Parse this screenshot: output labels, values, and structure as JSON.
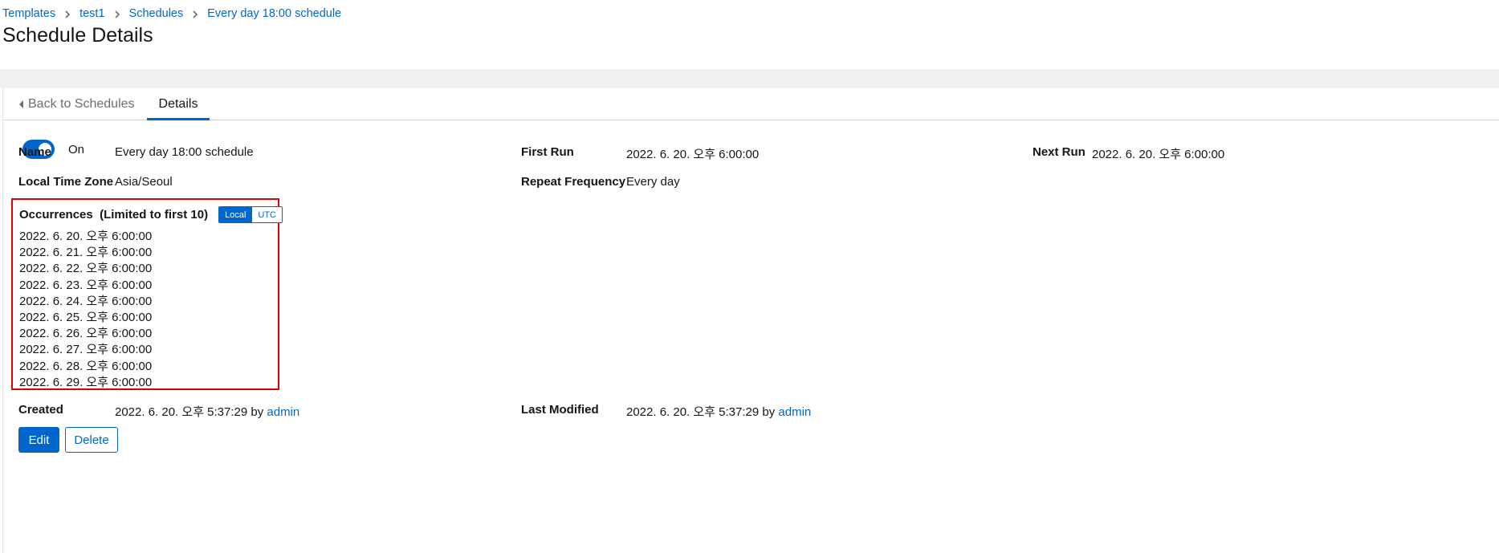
{
  "breadcrumb": {
    "items": [
      "Templates",
      "test1",
      "Schedules",
      "Every day 18:00 schedule"
    ]
  },
  "page": {
    "title": "Schedule Details"
  },
  "tabs": {
    "back_label": "Back to Schedules",
    "details_label": "Details"
  },
  "schedule": {
    "enabled": true,
    "toggle_label": "On",
    "name_label": "Name",
    "name_value": "Every day 18:00 schedule",
    "first_run_label": "First Run",
    "first_run_value": "2022. 6. 20. 오후 6:00:00",
    "next_run_label": "Next Run",
    "next_run_value": "2022. 6. 20. 오후 6:00:00",
    "timezone_label": "Local Time Zone",
    "timezone_value": "Asia/Seoul",
    "repeat_label": "Repeat Frequency",
    "repeat_value": "Every day"
  },
  "occurrences": {
    "title": "Occurrences",
    "limit_note": "(Limited to first 10)",
    "local_label": "Local",
    "utc_label": "UTC",
    "selected": "Local",
    "items": [
      "2022. 6. 20. 오후 6:00:00",
      "2022. 6. 21. 오후 6:00:00",
      "2022. 6. 22. 오후 6:00:00",
      "2022. 6. 23. 오후 6:00:00",
      "2022. 6. 24. 오후 6:00:00",
      "2022. 6. 25. 오후 6:00:00",
      "2022. 6. 26. 오후 6:00:00",
      "2022. 6. 27. 오후 6:00:00",
      "2022. 6. 28. 오후 6:00:00",
      "2022. 6. 29. 오후 6:00:00"
    ]
  },
  "audit": {
    "created_label": "Created",
    "created_value": "2022. 6. 20. 오후 5:37:29",
    "by_word": "by",
    "created_by": "admin",
    "modified_label": "Last Modified",
    "modified_value": "2022. 6. 20. 오후 5:37:29",
    "modified_by": "admin"
  },
  "actions": {
    "edit_label": "Edit",
    "delete_label": "Delete"
  },
  "colors": {
    "accent": "#0066cc",
    "highlight_border": "#e00000",
    "band": "#f0f0f0"
  }
}
